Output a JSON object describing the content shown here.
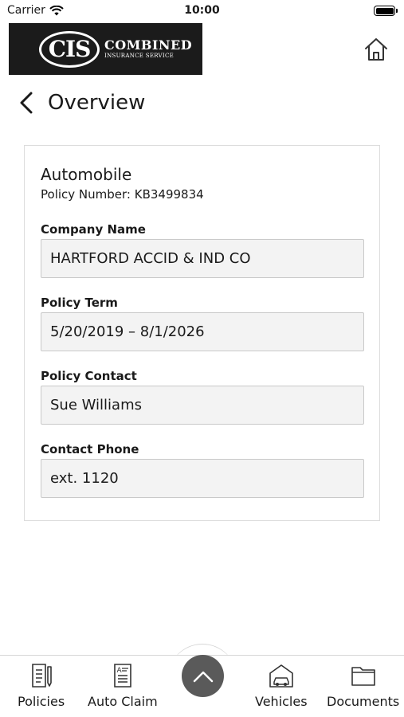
{
  "status_bar": {
    "carrier": "Carrier",
    "time": "10:00"
  },
  "header": {
    "logo_abbr": "CIS",
    "logo_main": "COMBINED",
    "logo_sub": "INSURANCE SERVICE",
    "home_icon": "home-icon"
  },
  "page": {
    "title": "Overview",
    "back_icon": "chevron-left-icon"
  },
  "policy": {
    "type": "Automobile",
    "number_line": "Policy Number: KB3499834",
    "fields": [
      {
        "label": "Company Name",
        "value": "HARTFORD ACCID & IND CO"
      },
      {
        "label": "Policy Term",
        "value": "5/20/2019 – 8/1/2026"
      },
      {
        "label": "Policy Contact",
        "value": "Sue Williams"
      },
      {
        "label": "Contact Phone",
        "value": "ext. 1120"
      }
    ]
  },
  "tab_bar": {
    "tabs": [
      {
        "label": "Policies",
        "icon": "policies-document-icon"
      },
      {
        "label": "Auto Claim",
        "icon": "auto-claim-form-icon"
      },
      {
        "label": "Vehicles",
        "icon": "vehicles-garage-icon"
      },
      {
        "label": "Documents",
        "icon": "folder-icon"
      }
    ],
    "center_icon": "chevron-up-icon",
    "center_button_color": "#5a5a5a"
  }
}
